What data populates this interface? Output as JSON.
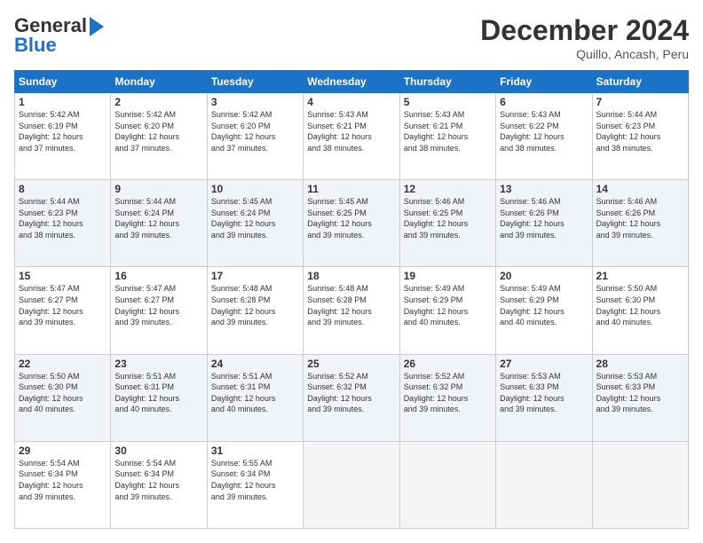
{
  "logo": {
    "line1": "General",
    "line2": "Blue"
  },
  "title": "December 2024",
  "subtitle": "Quillo, Ancash, Peru",
  "weekdays": [
    "Sunday",
    "Monday",
    "Tuesday",
    "Wednesday",
    "Thursday",
    "Friday",
    "Saturday"
  ],
  "weeks": [
    [
      {
        "day": "1",
        "info": "Sunrise: 5:42 AM\nSunset: 6:19 PM\nDaylight: 12 hours\nand 37 minutes."
      },
      {
        "day": "2",
        "info": "Sunrise: 5:42 AM\nSunset: 6:20 PM\nDaylight: 12 hours\nand 37 minutes."
      },
      {
        "day": "3",
        "info": "Sunrise: 5:42 AM\nSunset: 6:20 PM\nDaylight: 12 hours\nand 37 minutes."
      },
      {
        "day": "4",
        "info": "Sunrise: 5:43 AM\nSunset: 6:21 PM\nDaylight: 12 hours\nand 38 minutes."
      },
      {
        "day": "5",
        "info": "Sunrise: 5:43 AM\nSunset: 6:21 PM\nDaylight: 12 hours\nand 38 minutes."
      },
      {
        "day": "6",
        "info": "Sunrise: 5:43 AM\nSunset: 6:22 PM\nDaylight: 12 hours\nand 38 minutes."
      },
      {
        "day": "7",
        "info": "Sunrise: 5:44 AM\nSunset: 6:23 PM\nDaylight: 12 hours\nand 38 minutes."
      }
    ],
    [
      {
        "day": "8",
        "info": "Sunrise: 5:44 AM\nSunset: 6:23 PM\nDaylight: 12 hours\nand 38 minutes."
      },
      {
        "day": "9",
        "info": "Sunrise: 5:44 AM\nSunset: 6:24 PM\nDaylight: 12 hours\nand 39 minutes."
      },
      {
        "day": "10",
        "info": "Sunrise: 5:45 AM\nSunset: 6:24 PM\nDaylight: 12 hours\nand 39 minutes."
      },
      {
        "day": "11",
        "info": "Sunrise: 5:45 AM\nSunset: 6:25 PM\nDaylight: 12 hours\nand 39 minutes."
      },
      {
        "day": "12",
        "info": "Sunrise: 5:46 AM\nSunset: 6:25 PM\nDaylight: 12 hours\nand 39 minutes."
      },
      {
        "day": "13",
        "info": "Sunrise: 5:46 AM\nSunset: 6:26 PM\nDaylight: 12 hours\nand 39 minutes."
      },
      {
        "day": "14",
        "info": "Sunrise: 5:46 AM\nSunset: 6:26 PM\nDaylight: 12 hours\nand 39 minutes."
      }
    ],
    [
      {
        "day": "15",
        "info": "Sunrise: 5:47 AM\nSunset: 6:27 PM\nDaylight: 12 hours\nand 39 minutes."
      },
      {
        "day": "16",
        "info": "Sunrise: 5:47 AM\nSunset: 6:27 PM\nDaylight: 12 hours\nand 39 minutes."
      },
      {
        "day": "17",
        "info": "Sunrise: 5:48 AM\nSunset: 6:28 PM\nDaylight: 12 hours\nand 39 minutes."
      },
      {
        "day": "18",
        "info": "Sunrise: 5:48 AM\nSunset: 6:28 PM\nDaylight: 12 hours\nand 39 minutes."
      },
      {
        "day": "19",
        "info": "Sunrise: 5:49 AM\nSunset: 6:29 PM\nDaylight: 12 hours\nand 40 minutes."
      },
      {
        "day": "20",
        "info": "Sunrise: 5:49 AM\nSunset: 6:29 PM\nDaylight: 12 hours\nand 40 minutes."
      },
      {
        "day": "21",
        "info": "Sunrise: 5:50 AM\nSunset: 6:30 PM\nDaylight: 12 hours\nand 40 minutes."
      }
    ],
    [
      {
        "day": "22",
        "info": "Sunrise: 5:50 AM\nSunset: 6:30 PM\nDaylight: 12 hours\nand 40 minutes."
      },
      {
        "day": "23",
        "info": "Sunrise: 5:51 AM\nSunset: 6:31 PM\nDaylight: 12 hours\nand 40 minutes."
      },
      {
        "day": "24",
        "info": "Sunrise: 5:51 AM\nSunset: 6:31 PM\nDaylight: 12 hours\nand 40 minutes."
      },
      {
        "day": "25",
        "info": "Sunrise: 5:52 AM\nSunset: 6:32 PM\nDaylight: 12 hours\nand 39 minutes."
      },
      {
        "day": "26",
        "info": "Sunrise: 5:52 AM\nSunset: 6:32 PM\nDaylight: 12 hours\nand 39 minutes."
      },
      {
        "day": "27",
        "info": "Sunrise: 5:53 AM\nSunset: 6:33 PM\nDaylight: 12 hours\nand 39 minutes."
      },
      {
        "day": "28",
        "info": "Sunrise: 5:53 AM\nSunset: 6:33 PM\nDaylight: 12 hours\nand 39 minutes."
      }
    ],
    [
      {
        "day": "29",
        "info": "Sunrise: 5:54 AM\nSunset: 6:34 PM\nDaylight: 12 hours\nand 39 minutes."
      },
      {
        "day": "30",
        "info": "Sunrise: 5:54 AM\nSunset: 6:34 PM\nDaylight: 12 hours\nand 39 minutes."
      },
      {
        "day": "31",
        "info": "Sunrise: 5:55 AM\nSunset: 6:34 PM\nDaylight: 12 hours\nand 39 minutes."
      },
      {
        "day": "",
        "info": ""
      },
      {
        "day": "",
        "info": ""
      },
      {
        "day": "",
        "info": ""
      },
      {
        "day": "",
        "info": ""
      }
    ]
  ]
}
